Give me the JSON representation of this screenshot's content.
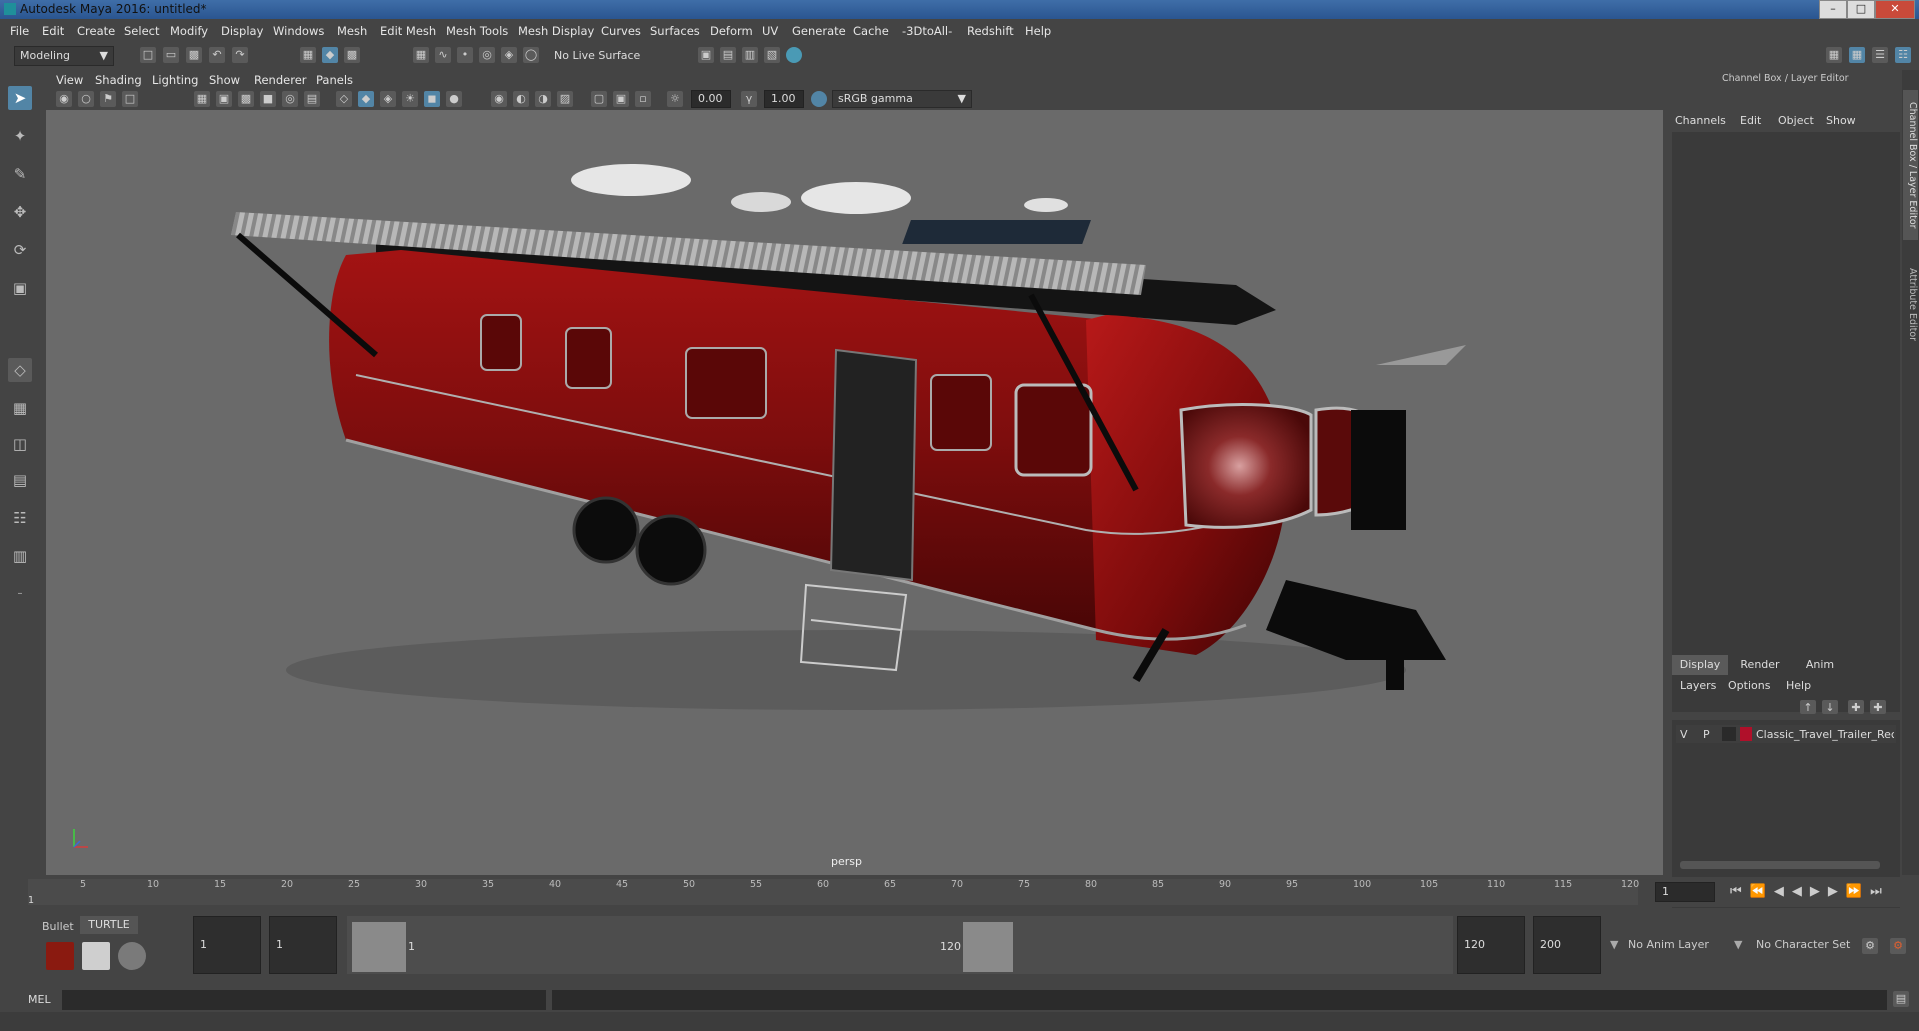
{
  "window": {
    "title": "Autodesk Maya 2016: untitled*"
  },
  "menubar": {
    "items": [
      "File",
      "Edit",
      "Create",
      "Select",
      "Modify",
      "Display",
      "Windows",
      "Mesh",
      "Edit Mesh",
      "Mesh Tools",
      "Mesh Display",
      "Curves",
      "Surfaces",
      "Deform",
      "UV",
      "Generate",
      "Cache",
      "-3DtoAll-",
      "Redshift",
      "Help"
    ]
  },
  "toolbar": {
    "mode": "Modeling",
    "live_surface": "No Live Surface"
  },
  "viewport": {
    "menu": [
      "View",
      "Shading",
      "Lighting",
      "Show",
      "Renderer",
      "Panels"
    ],
    "exposure": "0.00",
    "gamma": "1.00",
    "colorspace": "sRGB gamma",
    "camera_label": "persp"
  },
  "channel_box": {
    "title": "Channel Box / Layer Editor",
    "menu": [
      "Channels",
      "Edit",
      "Object",
      "Show"
    ]
  },
  "layer_editor": {
    "tabs": [
      "Display",
      "Render",
      "Anim"
    ],
    "active_tab": "Display",
    "menu": [
      "Layers",
      "Options",
      "Help"
    ],
    "layer": {
      "v": "V",
      "p": "P",
      "name": "Classic_Travel_Trailer_Rec",
      "color": "#b0102a"
    }
  },
  "side_tabs": [
    "Channel Box / Layer Editor",
    "Attribute Editor"
  ],
  "timeline": {
    "ticks": [
      "5",
      "10",
      "15",
      "20",
      "25",
      "30",
      "35",
      "40",
      "45",
      "50",
      "55",
      "60",
      "65",
      "70",
      "75",
      "80",
      "85",
      "90",
      "95",
      "100",
      "105",
      "110",
      "115",
      "120"
    ],
    "start_marker": "1",
    "current_frame": "1"
  },
  "range": {
    "shelf_tabs": [
      "Bullet",
      "TURTLE"
    ],
    "start": "1",
    "playback_start": "1",
    "slider_start": "1",
    "slider_end": "120",
    "playback_end": "120",
    "end": "200",
    "anim_layer": "No Anim Layer",
    "character_set": "No Character Set"
  },
  "cmdline": {
    "label": "MEL"
  },
  "colors": {
    "trailer_red": "#7d0d0d",
    "viewport_bg": "#6a6a6a",
    "panel": "#444444"
  }
}
